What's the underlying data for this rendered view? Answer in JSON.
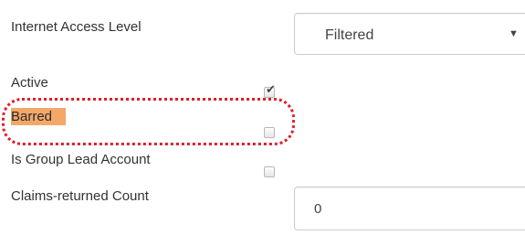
{
  "fields": {
    "internet_access_level": {
      "label": "Internet Access Level",
      "value": "Filtered",
      "arrow": "▼"
    },
    "active": {
      "label": "Active",
      "checked": true,
      "mark": "✔"
    },
    "barred": {
      "label": "Barred",
      "checked": false
    },
    "is_group_lead": {
      "label": "Is Group Lead Account",
      "checked": false
    },
    "claims_returned": {
      "label": "Claims-returned Count",
      "value": "0"
    }
  },
  "colors": {
    "highlight": "#f3a86a",
    "annotation_ring": "#e01e2a"
  }
}
